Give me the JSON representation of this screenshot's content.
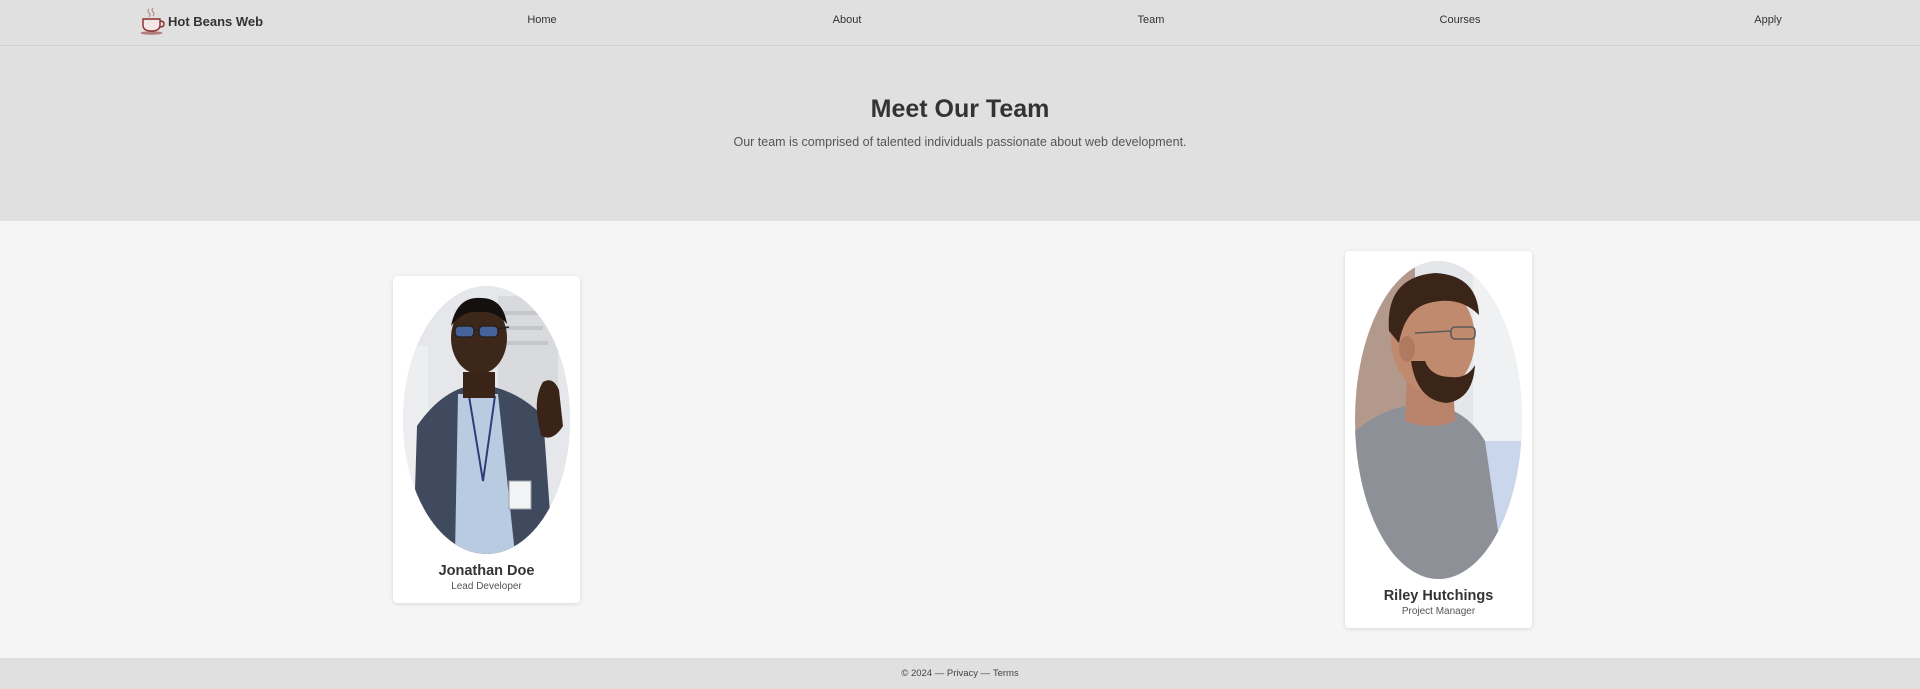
{
  "brand": {
    "name": "Hot Beans Web",
    "logo_icon": "coffee-cup-icon",
    "logo_color": "#8a2b2b"
  },
  "nav": {
    "links": [
      {
        "label": "Home"
      },
      {
        "label": "About"
      },
      {
        "label": "Team"
      },
      {
        "label": "Courses"
      },
      {
        "label": "Apply"
      }
    ]
  },
  "hero": {
    "title": "Meet Our Team",
    "subtitle": "Our team is comprised of talented individuals passionate about web development."
  },
  "team": [
    {
      "name": "Jonathan Doe",
      "role": "Lead Developer"
    },
    {
      "name": "Riley Hutchings",
      "role": "Project Manager"
    }
  ],
  "footer": {
    "copyright": "© 2024",
    "separator": " — ",
    "privacy": "Privacy",
    "terms": "Terms"
  },
  "colors": {
    "header_bg": "#e0e0e0",
    "page_bg": "#f5f5f5",
    "card_bg": "#ffffff",
    "text": "#333333"
  }
}
